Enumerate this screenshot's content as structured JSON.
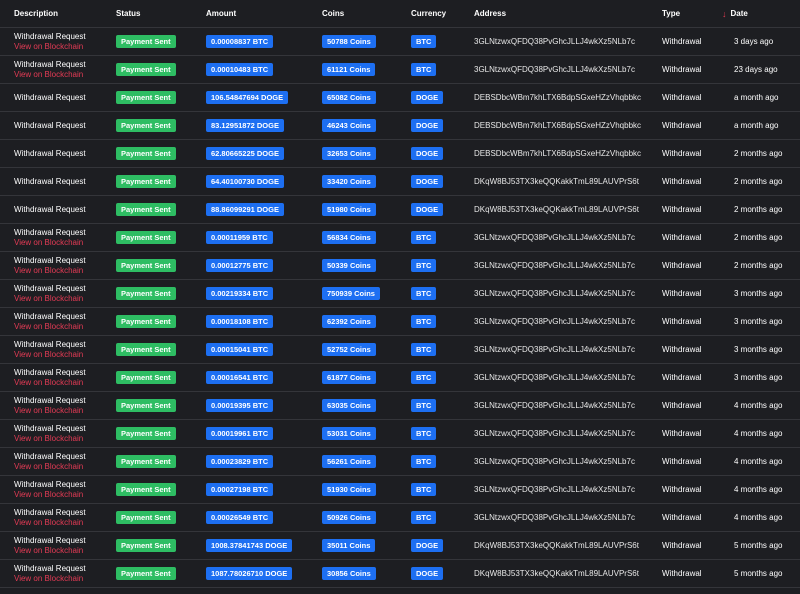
{
  "headers": {
    "description": "Description",
    "status": "Status",
    "amount": "Amount",
    "coins": "Coins",
    "currency": "Currency",
    "address": "Address",
    "type": "Type",
    "date": "Date",
    "sort_icon": "↓"
  },
  "colors": {
    "background": "#1d1e22",
    "status_green": "#2ebd63",
    "badge_blue": "#1d6ff2",
    "link_red": "#e43b55"
  },
  "rows": [
    {
      "description": "Withdrawal Request",
      "link": "View on Blockchain",
      "status": "Payment Sent",
      "amount": "0.00008837 BTC",
      "coins": "50788 Coins",
      "currency": "BTC",
      "address": "3GLNtzwxQFDQ38PvGhcJLLJ4wkXz5NLb7c",
      "type": "Withdrawal",
      "date": "3 days ago"
    },
    {
      "description": "Withdrawal Request",
      "link": "View on Blockchain",
      "status": "Payment Sent",
      "amount": "0.00010483 BTC",
      "coins": "61121 Coins",
      "currency": "BTC",
      "address": "3GLNtzwxQFDQ38PvGhcJLLJ4wkXz5NLb7c",
      "type": "Withdrawal",
      "date": "23 days ago"
    },
    {
      "description": "Withdrawal Request",
      "link": "",
      "status": "Payment Sent",
      "amount": "106.54847694 DOGE",
      "coins": "65082 Coins",
      "currency": "DOGE",
      "address": "DEBSDbcWBm7khLTX6BdpSGxeHZzVhqbbkc",
      "type": "Withdrawal",
      "date": "a month ago"
    },
    {
      "description": "Withdrawal Request",
      "link": "",
      "status": "Payment Sent",
      "amount": "83.12951872 DOGE",
      "coins": "46243 Coins",
      "currency": "DOGE",
      "address": "DEBSDbcWBm7khLTX6BdpSGxeHZzVhqbbkc",
      "type": "Withdrawal",
      "date": "a month ago"
    },
    {
      "description": "Withdrawal Request",
      "link": "",
      "status": "Payment Sent",
      "amount": "62.80665225 DOGE",
      "coins": "32653 Coins",
      "currency": "DOGE",
      "address": "DEBSDbcWBm7khLTX6BdpSGxeHZzVhqbbkc",
      "type": "Withdrawal",
      "date": "2 months ago"
    },
    {
      "description": "Withdrawal Request",
      "link": "",
      "status": "Payment Sent",
      "amount": "64.40100730 DOGE",
      "coins": "33420 Coins",
      "currency": "DOGE",
      "address": "DKqW8BJ53TX3keQQKakkTmL89LAUVPrS6t",
      "type": "Withdrawal",
      "date": "2 months ago"
    },
    {
      "description": "Withdrawal Request",
      "link": "",
      "status": "Payment Sent",
      "amount": "88.86099291 DOGE",
      "coins": "51980 Coins",
      "currency": "DOGE",
      "address": "DKqW8BJ53TX3keQQKakkTmL89LAUVPrS6t",
      "type": "Withdrawal",
      "date": "2 months ago"
    },
    {
      "description": "Withdrawal Request",
      "link": "View on Blockchain",
      "status": "Payment Sent",
      "amount": "0.00011959 BTC",
      "coins": "56834 Coins",
      "currency": "BTC",
      "address": "3GLNtzwxQFDQ38PvGhcJLLJ4wkXz5NLb7c",
      "type": "Withdrawal",
      "date": "2 months ago"
    },
    {
      "description": "Withdrawal Request",
      "link": "View on Blockchain",
      "status": "Payment Sent",
      "amount": "0.00012775 BTC",
      "coins": "50339 Coins",
      "currency": "BTC",
      "address": "3GLNtzwxQFDQ38PvGhcJLLJ4wkXz5NLb7c",
      "type": "Withdrawal",
      "date": "2 months ago"
    },
    {
      "description": "Withdrawal Request",
      "link": "View on Blockchain",
      "status": "Payment Sent",
      "amount": "0.00219334 BTC",
      "coins": "750939 Coins",
      "currency": "BTC",
      "address": "3GLNtzwxQFDQ38PvGhcJLLJ4wkXz5NLb7c",
      "type": "Withdrawal",
      "date": "3 months ago"
    },
    {
      "description": "Withdrawal Request",
      "link": "View on Blockchain",
      "status": "Payment Sent",
      "amount": "0.00018108 BTC",
      "coins": "62392 Coins",
      "currency": "BTC",
      "address": "3GLNtzwxQFDQ38PvGhcJLLJ4wkXz5NLb7c",
      "type": "Withdrawal",
      "date": "3 months ago"
    },
    {
      "description": "Withdrawal Request",
      "link": "View on Blockchain",
      "status": "Payment Sent",
      "amount": "0.00015041 BTC",
      "coins": "52752 Coins",
      "currency": "BTC",
      "address": "3GLNtzwxQFDQ38PvGhcJLLJ4wkXz5NLb7c",
      "type": "Withdrawal",
      "date": "3 months ago"
    },
    {
      "description": "Withdrawal Request",
      "link": "View on Blockchain",
      "status": "Payment Sent",
      "amount": "0.00016541 BTC",
      "coins": "61877 Coins",
      "currency": "BTC",
      "address": "3GLNtzwxQFDQ38PvGhcJLLJ4wkXz5NLb7c",
      "type": "Withdrawal",
      "date": "3 months ago"
    },
    {
      "description": "Withdrawal Request",
      "link": "View on Blockchain",
      "status": "Payment Sent",
      "amount": "0.00019395 BTC",
      "coins": "63035 Coins",
      "currency": "BTC",
      "address": "3GLNtzwxQFDQ38PvGhcJLLJ4wkXz5NLb7c",
      "type": "Withdrawal",
      "date": "4 months ago"
    },
    {
      "description": "Withdrawal Request",
      "link": "View on Blockchain",
      "status": "Payment Sent",
      "amount": "0.00019961 BTC",
      "coins": "53031 Coins",
      "currency": "BTC",
      "address": "3GLNtzwxQFDQ38PvGhcJLLJ4wkXz5NLb7c",
      "type": "Withdrawal",
      "date": "4 months ago"
    },
    {
      "description": "Withdrawal Request",
      "link": "View on Blockchain",
      "status": "Payment Sent",
      "amount": "0.00023829 BTC",
      "coins": "56261 Coins",
      "currency": "BTC",
      "address": "3GLNtzwxQFDQ38PvGhcJLLJ4wkXz5NLb7c",
      "type": "Withdrawal",
      "date": "4 months ago"
    },
    {
      "description": "Withdrawal Request",
      "link": "View on Blockchain",
      "status": "Payment Sent",
      "amount": "0.00027198 BTC",
      "coins": "51930 Coins",
      "currency": "BTC",
      "address": "3GLNtzwxQFDQ38PvGhcJLLJ4wkXz5NLb7c",
      "type": "Withdrawal",
      "date": "4 months ago"
    },
    {
      "description": "Withdrawal Request",
      "link": "View on Blockchain",
      "status": "Payment Sent",
      "amount": "0.00026549 BTC",
      "coins": "50926 Coins",
      "currency": "BTC",
      "address": "3GLNtzwxQFDQ38PvGhcJLLJ4wkXz5NLb7c",
      "type": "Withdrawal",
      "date": "4 months ago"
    },
    {
      "description": "Withdrawal Request",
      "link": "View on Blockchain",
      "status": "Payment Sent",
      "amount": "1008.37841743 DOGE",
      "coins": "35011 Coins",
      "currency": "DOGE",
      "address": "DKqW8BJ53TX3keQQKakkTmL89LAUVPrS6t",
      "type": "Withdrawal",
      "date": "5 months ago"
    },
    {
      "description": "Withdrawal Request",
      "link": "View on Blockchain",
      "status": "Payment Sent",
      "amount": "1087.78026710 DOGE",
      "coins": "30856 Coins",
      "currency": "DOGE",
      "address": "DKqW8BJ53TX3keQQKakkTmL89LAUVPrS6t",
      "type": "Withdrawal",
      "date": "5 months ago"
    }
  ]
}
